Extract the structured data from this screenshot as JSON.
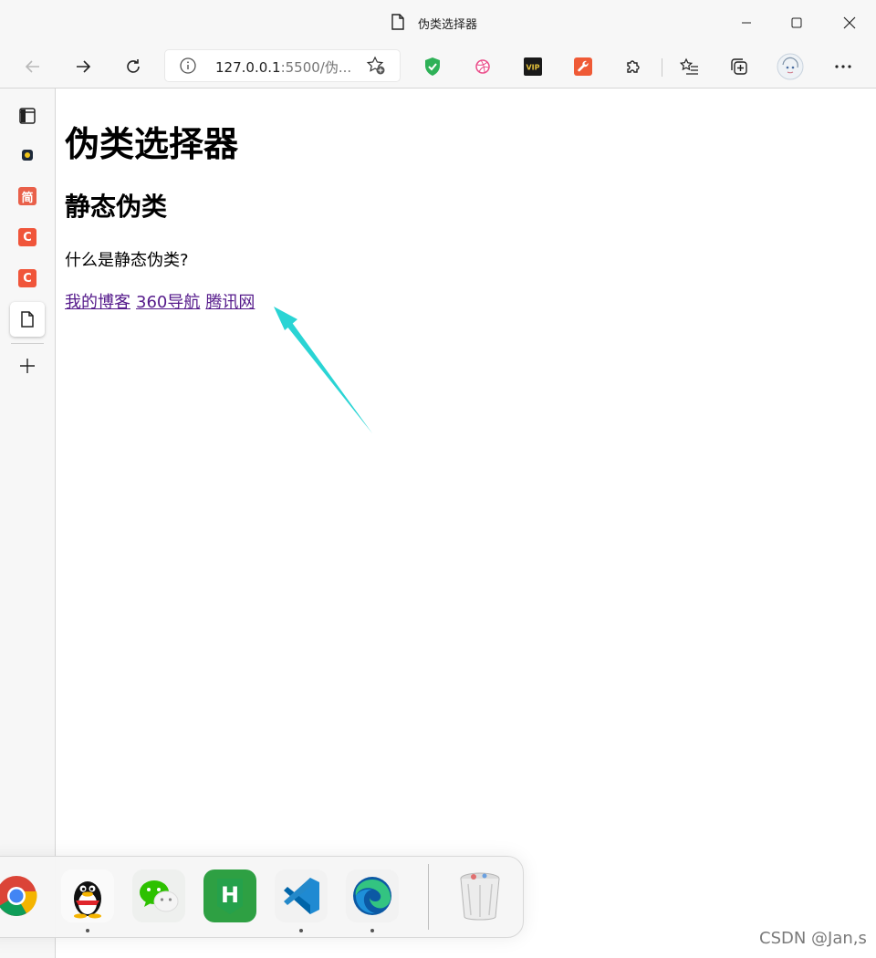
{
  "window": {
    "tab_title": "伪类选择器"
  },
  "toolbar": {
    "url_host": "127.0.0.1",
    "url_rest": ":5500/伪..."
  },
  "sidebar": {
    "items": [
      {
        "name": "tabs",
        "icon": "layout-icon"
      },
      {
        "name": "juejin",
        "icon": "juejin-icon"
      },
      {
        "name": "jianshu",
        "icon": "jianshu-icon",
        "label": "简",
        "color": "#e9604a"
      },
      {
        "name": "csdn-1",
        "icon": "csdn-icon",
        "label": "C",
        "color": "#f0553a"
      },
      {
        "name": "csdn-2",
        "icon": "csdn-icon",
        "label": "C",
        "color": "#f0553a"
      },
      {
        "name": "file",
        "icon": "file-icon"
      },
      {
        "name": "add",
        "icon": "plus-icon"
      }
    ]
  },
  "page": {
    "h1": "伪类选择器",
    "h2": "静态伪类",
    "paragraph": "什么是静态伪类?",
    "links": [
      "我的博客",
      "360导航",
      "腾讯网"
    ]
  },
  "dock": {
    "apps": [
      {
        "name": "chrome",
        "running": false
      },
      {
        "name": "qq",
        "running": true
      },
      {
        "name": "wechat",
        "running": false
      },
      {
        "name": "hbuilder",
        "running": false,
        "label": "H"
      },
      {
        "name": "vscode",
        "running": true
      },
      {
        "name": "edge",
        "running": true
      },
      {
        "name": "trash",
        "running": false
      }
    ]
  },
  "watermark": "CSDN @Jan,s",
  "colors": {
    "link_visited": "#551a8b",
    "arrow": "#2ad4d4"
  }
}
